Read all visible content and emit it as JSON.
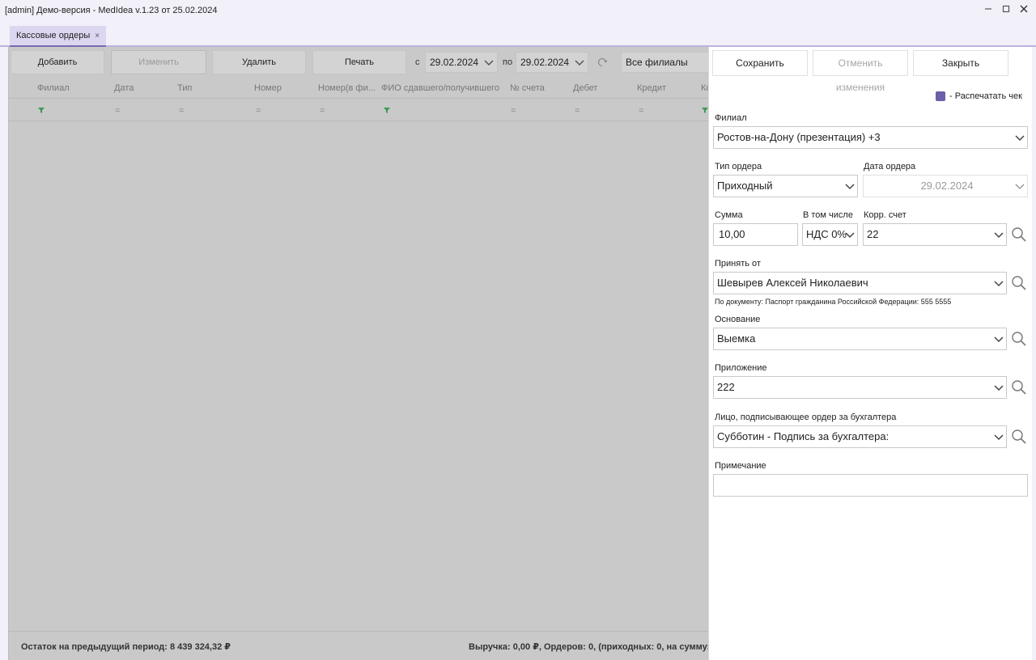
{
  "window": {
    "title": "[admin] Демо-версия  - MedIdea v.1.23 от 25.02.2024",
    "minimize_icon": "minimize-icon",
    "maximize_icon": "maximize-icon",
    "close_icon": "close-icon"
  },
  "tabs": [
    {
      "label": "Кассовые ордеры",
      "close": "×"
    }
  ],
  "toolbar": {
    "add": "Добавить",
    "edit": "Изменить",
    "delete": "Удалить",
    "print": "Печать",
    "from_label": "с",
    "from_date": "29.02.2024",
    "to_label": "по",
    "to_date": "29.02.2024",
    "branches": "Все филиалы"
  },
  "grid": {
    "columns": [
      "Филиал",
      "Дата",
      "Тип",
      "Номер",
      "Номер(в фи...",
      "ФИО сдавшего/получившего",
      "№ счета",
      "Дебет",
      "Кредит",
      "Ко"
    ],
    "filter_symbol": "="
  },
  "status": {
    "left": "Остаток на предыдущий период: 8 439 324,32 ₽",
    "right": "Выручка: 0,00 ₽, Ордеров: 0, (приходных: 0, на сумму:"
  },
  "panel": {
    "save": "Сохранить",
    "cancel_changes": "Отменить изменения",
    "close": "Закрыть",
    "print_receipt": "- Распечатать чек",
    "branch_label": "Филиал",
    "branch_value": "Ростов-на-Дону (презентация) +3",
    "order_type_label": "Тип ордера",
    "order_type_value": "Приходный",
    "order_date_label": "Дата ордера",
    "order_date_value": "29.02.2024",
    "amount_label": "Сумма",
    "amount_value": "10,00",
    "vat_label": "В том числе",
    "vat_value": "НДС 0%",
    "account_label": "Корр. счет",
    "account_value": "22",
    "received_from_label": "Принять от",
    "received_from_value": "Шевырев  Алексей  Николаевич",
    "document_note": "По документу: Паспорт гражданина Российской Федерации: 555 5555",
    "basis_label": "Основание",
    "basis_value": "Выемка",
    "attachment_label": "Приложение",
    "attachment_value": "222",
    "signer_label": "Лицо, подписывающее ордер за бухгалтера",
    "signer_value": "Субботин - Подпись за бухгалтера:",
    "note_label": "Примечание",
    "note_value": ""
  },
  "colors": {
    "accent": "#6d5fa8",
    "tab_active": "#dcd6f0",
    "grid_bg": "#c9c9c9",
    "window_bg": "#f2f0f8"
  }
}
